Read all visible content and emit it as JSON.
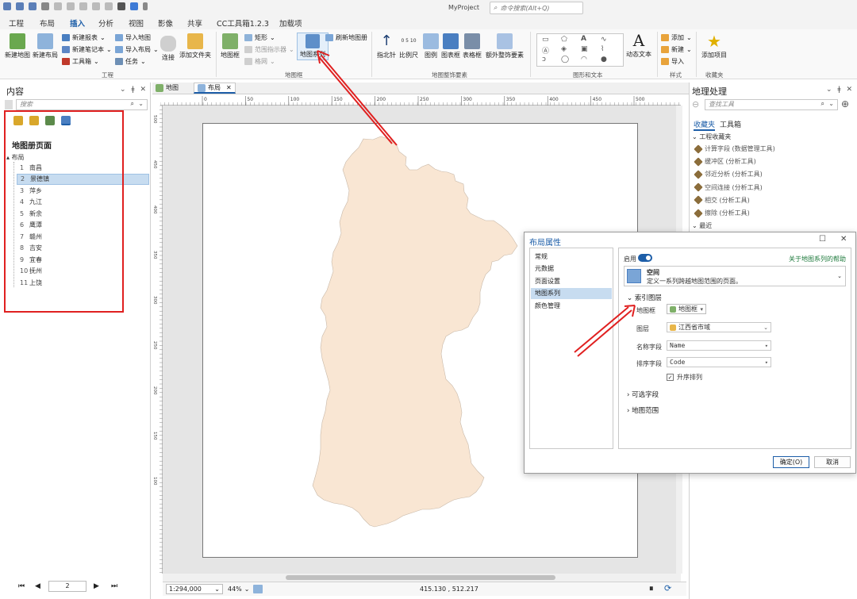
{
  "title": {
    "project": "MyProject",
    "search_placeholder": "命令搜索(Alt+Q)"
  },
  "tabs": [
    "工程",
    "布局",
    "插入",
    "分析",
    "视图",
    "影像",
    "共享",
    "CC工具箱1.2.3",
    "加载项"
  ],
  "active_tab": "插入",
  "ribbon": {
    "project_group": {
      "label": "工程",
      "new_map": "新建地图",
      "new_layout": "新建布局",
      "new_report": "新建报表",
      "new_notebook": "新建笔记本",
      "toolbox": "工具箱",
      "import_map": "导入地图",
      "import_layout": "导入布局",
      "task": "任务",
      "connect": "连接",
      "add_folder": "添加文件夹"
    },
    "mapframe_group": {
      "label": "地图框",
      "map_frame": "地图框",
      "rectangle": "矩形",
      "extent_indicator": "范围指示器",
      "grid": "格网",
      "map_series": "地图系列",
      "refresh_series": "刷新地图册"
    },
    "surround_group": {
      "label": "地图整饰要素",
      "north_arrow": "指北针",
      "scale_bar": "比例尺",
      "legend": "图例",
      "chart_frame": "图表框",
      "table_frame": "表格框",
      "extra_surround": "额外整饰要素",
      "scale_ticks": "0 5 10"
    },
    "graphics_group": {
      "label": "图形和文本",
      "dynamic_text": "动态文本"
    },
    "styles_group": {
      "label": "样式",
      "add": "添加",
      "new": "新建",
      "import": "导入"
    },
    "favorites_group": {
      "label": "收藏夹",
      "add_item": "添加项目"
    }
  },
  "contents": {
    "title": "内容",
    "search_placeholder": "搜索",
    "header": "地图册页面",
    "layout_label": "布局",
    "items": [
      {
        "num": "1",
        "name": "南昌"
      },
      {
        "num": "2",
        "name": "景德镇"
      },
      {
        "num": "3",
        "name": "萍乡"
      },
      {
        "num": "4",
        "name": "九江"
      },
      {
        "num": "5",
        "name": "新余"
      },
      {
        "num": "6",
        "name": "鹰潭"
      },
      {
        "num": "7",
        "name": "赣州"
      },
      {
        "num": "8",
        "name": "吉安"
      },
      {
        "num": "9",
        "name": "宜春"
      },
      {
        "num": "10",
        "name": "抚州"
      },
      {
        "num": "11",
        "name": "上饶"
      }
    ],
    "selected_index": 1,
    "page_input": "2"
  },
  "doc_tabs": {
    "map": "地图",
    "layout": "布局"
  },
  "ruler": {
    "h_ticks": [
      "0",
      "50",
      "100",
      "150",
      "200",
      "250",
      "300",
      "350",
      "400",
      "450",
      "500"
    ],
    "v_ticks": [
      "500",
      "450",
      "400",
      "350",
      "300",
      "250",
      "200",
      "150",
      "100"
    ]
  },
  "status": {
    "scale": "1:294,000",
    "zoom": "44%",
    "coords": "415.130 , 512.217"
  },
  "geoprocessing": {
    "title": "地理处理",
    "search_placeholder": "查找工具",
    "tab_favorites": "收藏夹",
    "tab_toolbox": "工具箱",
    "section_project": "工程收藏夹",
    "tools": [
      "计算字段 (数据管理工具)",
      "缓冲区 (分析工具)",
      "邻近分析 (分析工具)",
      "空间连接 (分析工具)",
      "相交 (分析工具)",
      "擦除 (分析工具)"
    ],
    "section_recent": "最近"
  },
  "dialog": {
    "title": "布局属性",
    "nav": [
      "常规",
      "元数据",
      "页面设置",
      "地图系列",
      "颜色管理"
    ],
    "nav_selected": 3,
    "enable_label": "启用",
    "help_link": "关于地图系列的帮助",
    "series_type_title": "空间",
    "series_type_desc": "定义一系列跨越地图范围的页面。",
    "index_section": "索引图层",
    "map_frame_label": "地图框",
    "map_frame_value": "地图框",
    "layer_label": "图层",
    "layer_value": "江西省市域",
    "name_field_label": "名称字段",
    "name_field_value": "Name",
    "sort_field_label": "排序字段",
    "sort_field_value": "Code",
    "ascending_label": "升序排列",
    "optional_section": "可选字段",
    "extent_section": "地图范围",
    "ok": "确定(O)",
    "cancel": "取消"
  },
  "colors": {
    "accent": "#1d5ea8",
    "annotation_red": "#e02020",
    "map_fill": "#f9e6d3",
    "selection": "#c7dcf0"
  }
}
